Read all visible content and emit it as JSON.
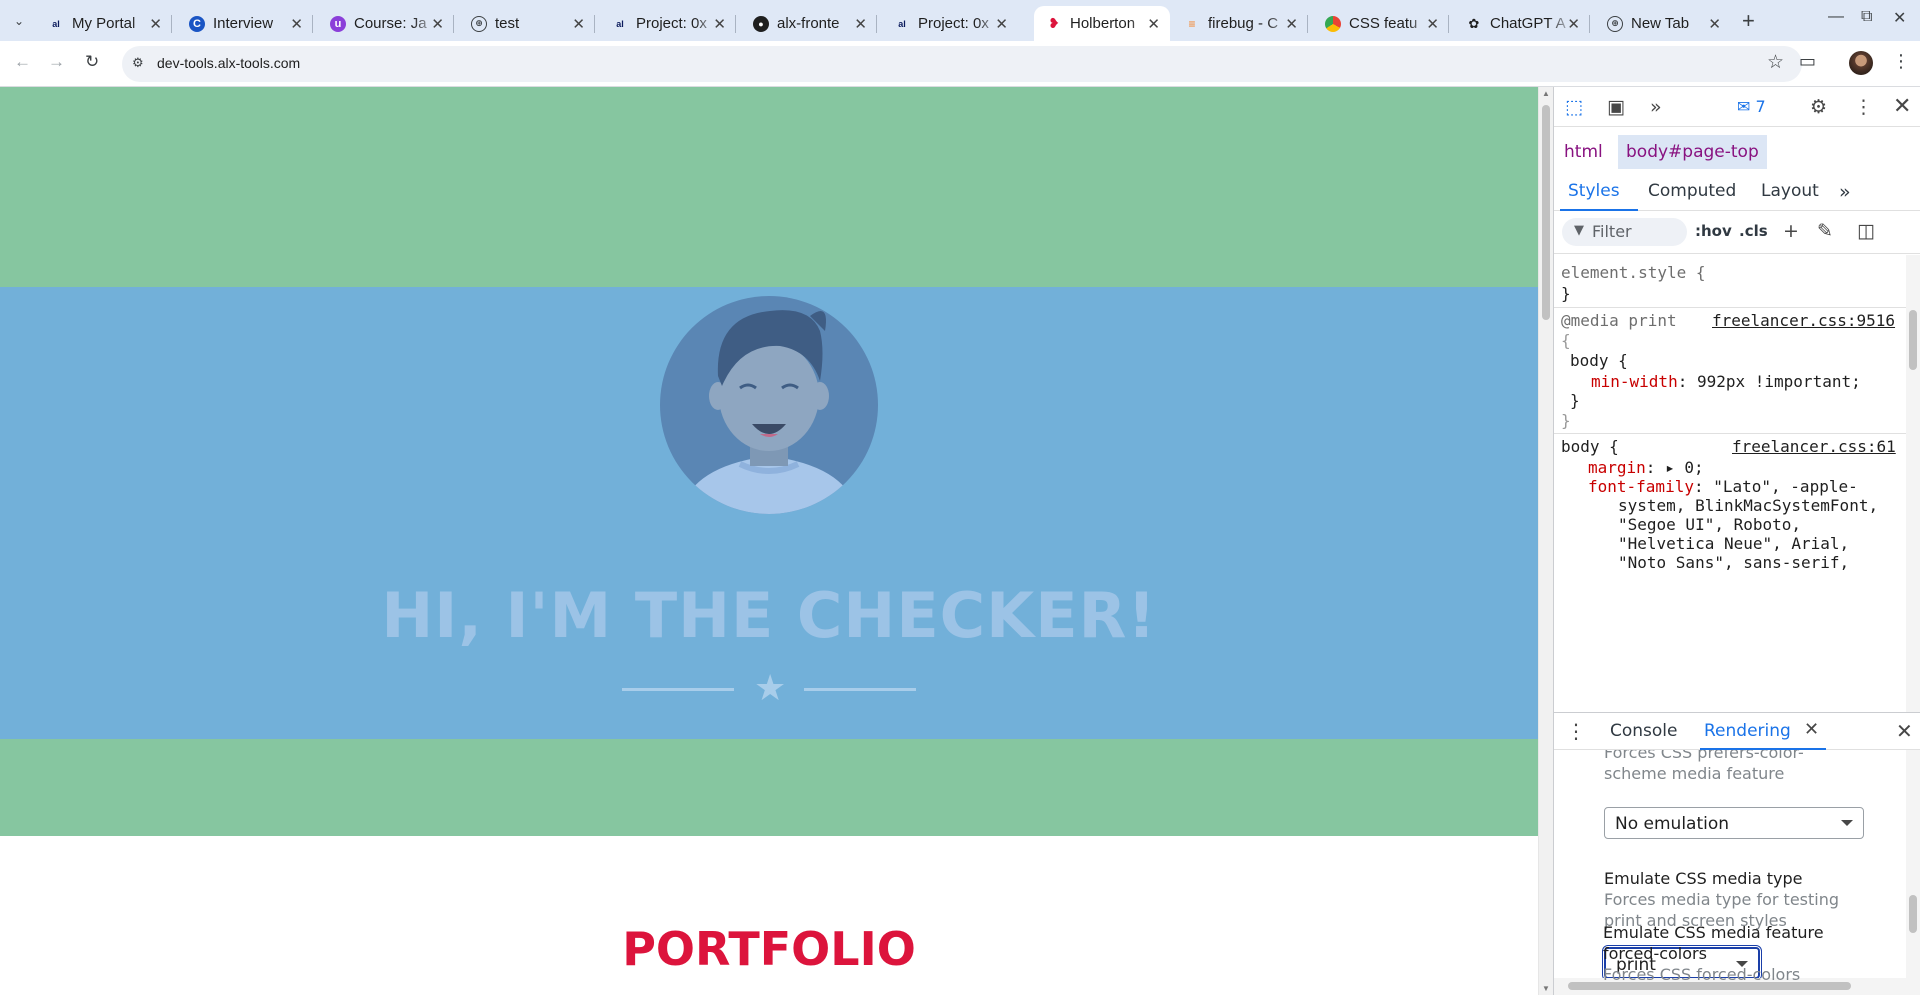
{
  "tabs": [
    {
      "title": "My Portal",
      "favicon": "alx-icon",
      "active": false
    },
    {
      "title": "Interview",
      "favicon": "c-logo-icon",
      "active": false
    },
    {
      "title": "Course: Ja",
      "favicon": "course-icon",
      "active": false
    },
    {
      "title": "test",
      "favicon": "globe-icon",
      "active": false
    },
    {
      "title": "Project: 0x",
      "favicon": "alx-icon",
      "active": false
    },
    {
      "title": "alx-fronte",
      "favicon": "github-icon",
      "active": false
    },
    {
      "title": "Project: 0x",
      "favicon": "alx-icon",
      "active": false
    },
    {
      "title": "Holberton",
      "favicon": "holberton-icon",
      "active": true
    },
    {
      "title": "firebug - C",
      "favicon": "stackoverflow-icon",
      "active": false
    },
    {
      "title": "CSS featu",
      "favicon": "chrome-icon",
      "active": false
    },
    {
      "title": "ChatGPT A",
      "favicon": "chatgpt-icon",
      "active": false
    },
    {
      "title": "New Tab",
      "favicon": "globe-icon",
      "active": false
    }
  ],
  "address_bar": {
    "url": "dev-tools.alx-tools.com"
  },
  "page": {
    "hero_title": "HI, I'M THE CHECKER!",
    "section_title": "PORTFOLIO",
    "colors": {
      "green_band": "#86c6a0",
      "blue_band": "#72b0d9",
      "accent": "#dc143c"
    }
  },
  "devtools": {
    "issues_count": "7",
    "breadcrumbs": [
      "html",
      "body#page-top"
    ],
    "subtabs": [
      "Styles",
      "Computed",
      "Layout"
    ],
    "active_subtab": "Styles",
    "filter_placeholder": "Filter",
    "filter_buttons": {
      "hov": ":hov",
      "cls": ".cls"
    },
    "styles": {
      "element_style_open": "element.style {",
      "close_brace": "}",
      "media_rule": "@media print",
      "media_source": "freelancer.css:9516",
      "open_brace": "{",
      "body_selector": "body {",
      "min_width_prop": "min-width",
      "min_width_val": "992px !important;",
      "body_rule_source": "freelancer.css:61",
      "margin_prop": "margin",
      "margin_val": "0;",
      "font_family_prop": "font-family",
      "font_family_lines": [
        "\"Lato\", -apple-",
        "system, BlinkMacSystemFont,",
        "\"Segoe UI\", Roboto,",
        "\"Helvetica Neue\", Arial,",
        "\"Noto Sans\", sans-serif,"
      ]
    },
    "drawer_tabs": [
      "Console",
      "Rendering"
    ],
    "active_drawer_tab": "Rendering",
    "rendering": {
      "color_scheme_desc": [
        "Forces CSS prefers-color-",
        "scheme media feature"
      ],
      "color_scheme_value": "No emulation",
      "media_type_heading": "Emulate CSS media type",
      "media_type_desc": [
        "Forces media type for testing",
        "print and screen styles"
      ],
      "media_type_value": "print",
      "forced_colors_heading": [
        "Emulate CSS media feature",
        "forced-colors"
      ],
      "forced_colors_desc": "Forces CSS forced-colors"
    }
  }
}
